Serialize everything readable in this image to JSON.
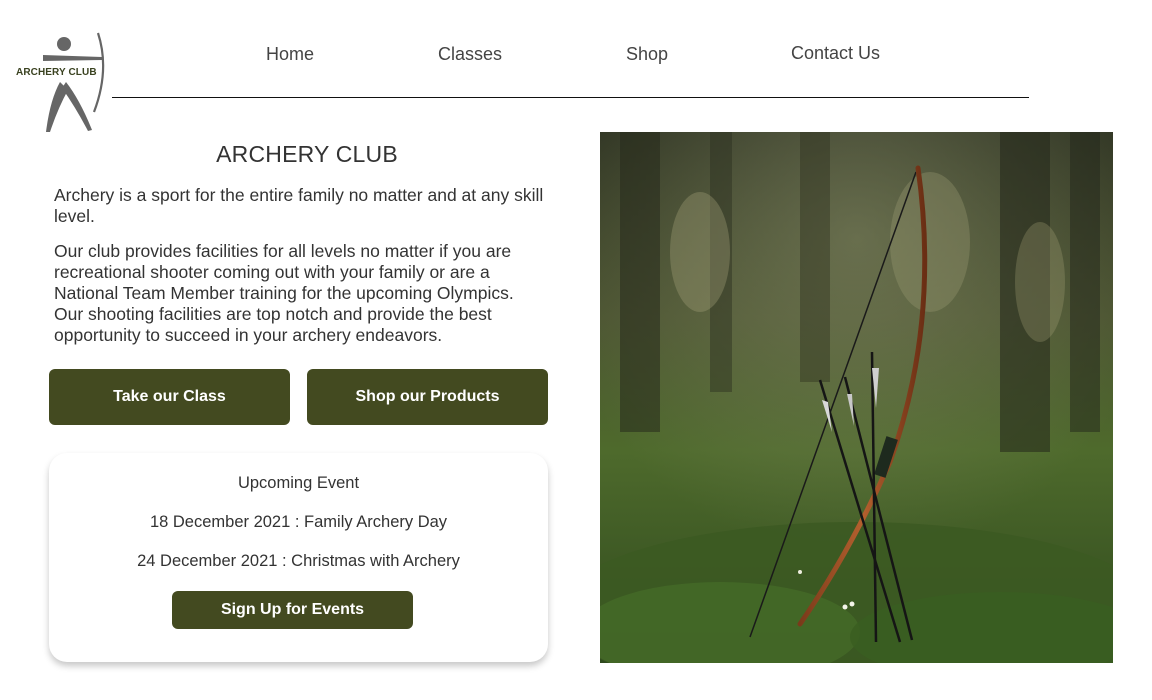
{
  "logo": {
    "text": "ARCHERY CLUB",
    "icon": "archer-logo-icon"
  },
  "nav": {
    "items": [
      {
        "label": "Home"
      },
      {
        "label": "Classes"
      },
      {
        "label": "Shop"
      },
      {
        "label": "Contact Us"
      }
    ]
  },
  "hero": {
    "title": "ARCHERY CLUB",
    "paragraph1": "Archery is a sport for the entire family no matter and at any skill level.",
    "paragraph2": "Our club provides facilities for all levels no matter if you are recreational shooter coming out with your family or are a National Team Member training for the upcoming Olympics. Our shooting facilities are top notch and provide the best opportunity to succeed in your archery endeavors."
  },
  "buttons": {
    "take_class": "Take our Class",
    "shop_products": "Shop our Products"
  },
  "events": {
    "heading": "Upcoming Event",
    "items": [
      "18 December 2021 : Family Archery Day",
      "24 December 2021 : Christmas with Archery"
    ],
    "signup_label": "Sign Up for Events"
  },
  "colors": {
    "accent": "#434a20",
    "text": "#333333",
    "rule": "#111111"
  },
  "photo": {
    "subject": "bow-and-arrows-in-forest-image"
  }
}
